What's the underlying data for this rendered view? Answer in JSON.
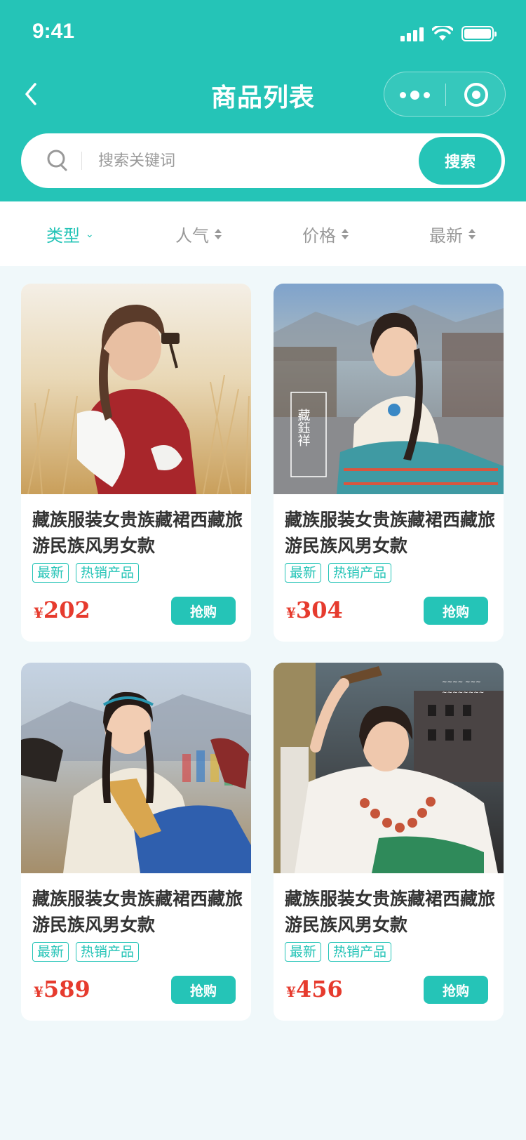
{
  "status_bar": {
    "time": "9:41"
  },
  "nav": {
    "title": "商品列表"
  },
  "search": {
    "placeholder": "搜索关键词",
    "button_label": "搜索"
  },
  "filters": [
    {
      "label": "类型",
      "active": true,
      "indicator": "chevron-down"
    },
    {
      "label": "人气",
      "active": false,
      "indicator": "sort"
    },
    {
      "label": "价格",
      "active": false,
      "indicator": "sort"
    },
    {
      "label": "最新",
      "active": false,
      "indicator": "sort"
    }
  ],
  "products": [
    {
      "title": "藏族服装女贵族藏裙西藏旅游民族风男女款",
      "tags": [
        "最新",
        "热销产品"
      ],
      "currency": "¥",
      "price": "202",
      "buy_label": "抢购",
      "image": "photo-woman-red-tibetan-robe-prayer-wheel-grassland"
    },
    {
      "title": "藏族服装女贵族藏裙西藏旅游民族风男女款",
      "tags": [
        "最新",
        "热销产品"
      ],
      "currency": "¥",
      "price": "304",
      "buy_label": "抢购",
      "image": "photo-woman-white-tibetan-dress-street",
      "image_caption": "藏鈺祥"
    },
    {
      "title": "藏族服装女贵族藏裙西藏旅游民族风男女款",
      "tags": [
        "最新",
        "热销产品"
      ],
      "currency": "¥",
      "price": "589",
      "buy_label": "抢购",
      "image": "photo-smiling-woman-blue-tibetan-dress-prayer-flags"
    },
    {
      "title": "藏族服装女贵族藏裙西藏旅游民族风男女款",
      "tags": [
        "最新",
        "热销产品"
      ],
      "currency": "¥",
      "price": "456",
      "buy_label": "抢购",
      "image": "photo-woman-coral-necklace-potala-palace"
    }
  ],
  "colors": {
    "primary": "#25c4b7",
    "price": "#e63b2e",
    "background": "#f0f8fa"
  }
}
